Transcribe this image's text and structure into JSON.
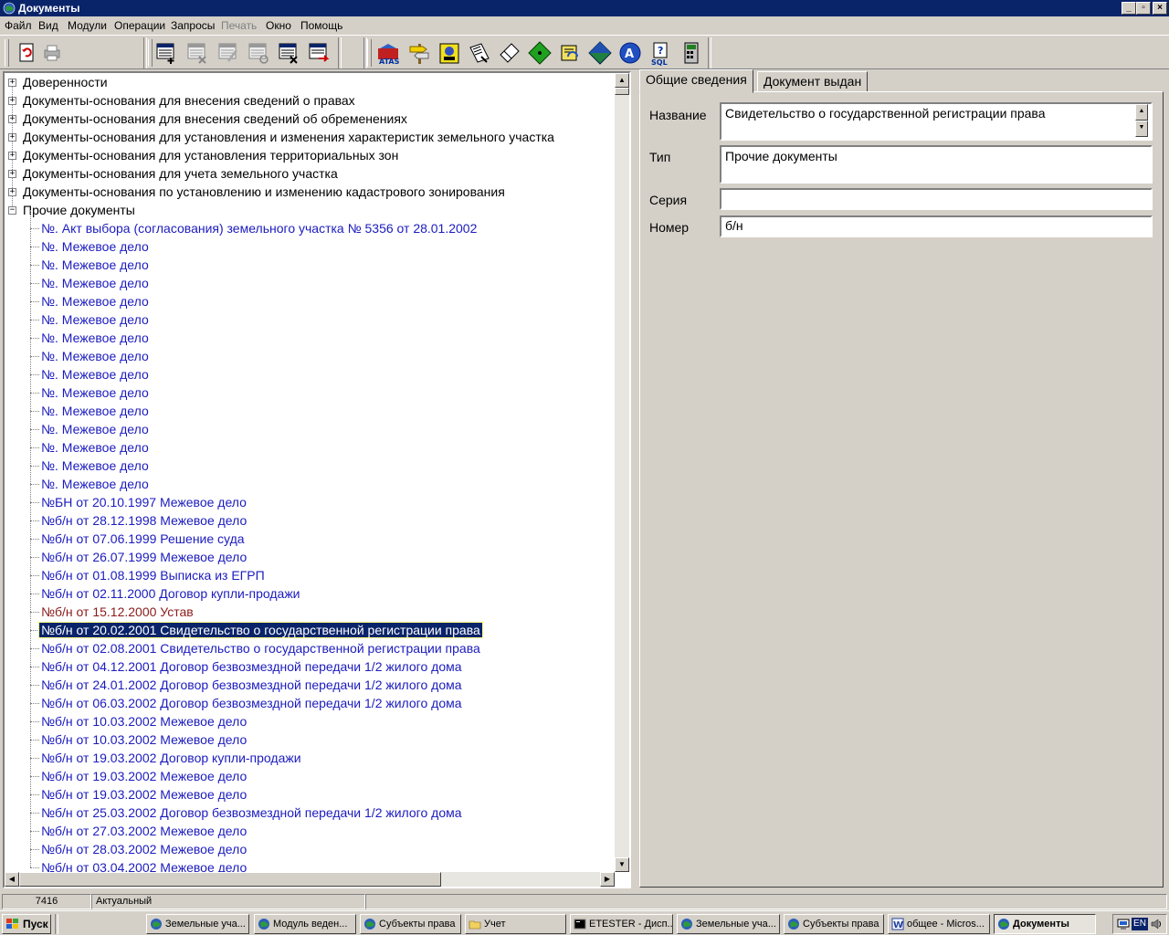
{
  "window": {
    "title": "Документы"
  },
  "menu": [
    {
      "label": "Файл",
      "disabled": false
    },
    {
      "label": "Вид",
      "disabled": false
    },
    {
      "label": "Модули",
      "disabled": false
    },
    {
      "label": "Операции",
      "disabled": false
    },
    {
      "label": "Запросы",
      "disabled": false
    },
    {
      "label": "Печать",
      "disabled": true
    },
    {
      "label": "Окно",
      "disabled": false
    },
    {
      "label": "Помощь",
      "disabled": false
    }
  ],
  "toolbar": {
    "icons": [
      "refresh-doc-icon",
      "print-icon",
      "add-record-icon",
      "delete-record-icon",
      "edit-record-icon",
      "view-record-icon",
      "cut-record-icon",
      "export-record-icon",
      "atlas-icon",
      "signpost-icon",
      "contacts-icon",
      "documents-icon",
      "eraser-icon",
      "green-diamond-icon",
      "refresh-note-icon",
      "map-diamond-icon",
      "compass-icon",
      "sql-query-icon",
      "calculator-icon"
    ]
  },
  "tree": {
    "groups": [
      "Доверенности",
      "Документы-основания для внесения сведений о правах",
      "Документы-основания для внесения сведений об обременениях",
      "Документы-основания для установления и изменения характеристик земельного участка",
      "Документы-основания для установления территориальных зон",
      "Документы-основания для учета земельного участка",
      "Документы-основания по установлению и изменению кадастрового зонирования",
      "Прочие документы"
    ],
    "documents": [
      "№. Акт выбора (согласования) земельного участка № 5356 от 28.01.2002",
      "№. Межевое дело",
      "№. Межевое дело",
      "№. Межевое дело",
      "№. Межевое дело",
      "№. Межевое дело",
      "№. Межевое дело",
      "№. Межевое дело",
      "№. Межевое дело",
      "№. Межевое дело",
      "№. Межевое дело",
      "№. Межевое дело",
      "№. Межевое дело",
      "№. Межевое дело",
      "№. Межевое дело",
      "№БН от 20.10.1997 Межевое дело",
      "№б/н от 28.12.1998 Межевое дело",
      "№б/н от 07.06.1999 Решение суда",
      "№б/н от 26.07.1999 Межевое дело",
      "№б/н от 01.08.1999 Выписка из ЕГРП",
      "№б/н от 02.11.2000 Договор купли-продажи",
      "№б/н от 15.12.2000 Устав",
      "№б/н от 20.02.2001 Свидетельство о государственной регистрации права",
      "№б/н от 02.08.2001 Свидетельство о государственной регистрации права",
      "№б/н от 04.12.2001 Договор безвозмездной передачи 1/2 жилого дома",
      "№б/н от 24.01.2002 Договор безвозмездной передачи 1/2 жилого дома",
      "№б/н от 06.03.2002 Договор безвозмездной передачи 1/2 жилого дома",
      "№б/н от 10.03.2002 Межевое дело",
      "№б/н от 10.03.2002 Межевое дело",
      "№б/н от 19.03.2002 Договор купли-продажи",
      "№б/н от 19.03.2002 Межевое дело",
      "№б/н от 19.03.2002 Межевое дело",
      "№б/н от 25.03.2002 Договор безвозмездной передачи 1/2 жилого дома",
      "№б/н от 27.03.2002 Межевое дело",
      "№б/н от 28.03.2002 Межевое дело",
      "№б/н от 03.04.2002 Межевое дело"
    ],
    "selected_index": 22,
    "highlighted_index": 21
  },
  "tabs": [
    "Общие сведения",
    "Документ выдан"
  ],
  "form": {
    "name_label": "Название",
    "name_value": "Свидетельство о государственной регистрации права",
    "type_label": "Тип",
    "type_value": "Прочие документы",
    "series_label": "Серия",
    "series_value": "",
    "number_label": "Номер",
    "number_value": "б/н"
  },
  "status": {
    "count": "7416",
    "state": "Актуальный"
  },
  "taskbar": {
    "start_label": "Пуск",
    "tasks": [
      {
        "label": "Земельные уча...",
        "active": false
      },
      {
        "label": "Модуль веден...",
        "active": false
      },
      {
        "label": "Субъекты права",
        "active": false
      },
      {
        "label": "Учет",
        "active": false
      },
      {
        "label": "ETESTER - Дисп...",
        "active": false
      },
      {
        "label": "Земельные уча...",
        "active": false
      },
      {
        "label": "Субъекты права",
        "active": false
      },
      {
        "label": "общее - Micros...",
        "active": false
      },
      {
        "label": "Документы",
        "active": true
      }
    ],
    "lang": "EN"
  }
}
